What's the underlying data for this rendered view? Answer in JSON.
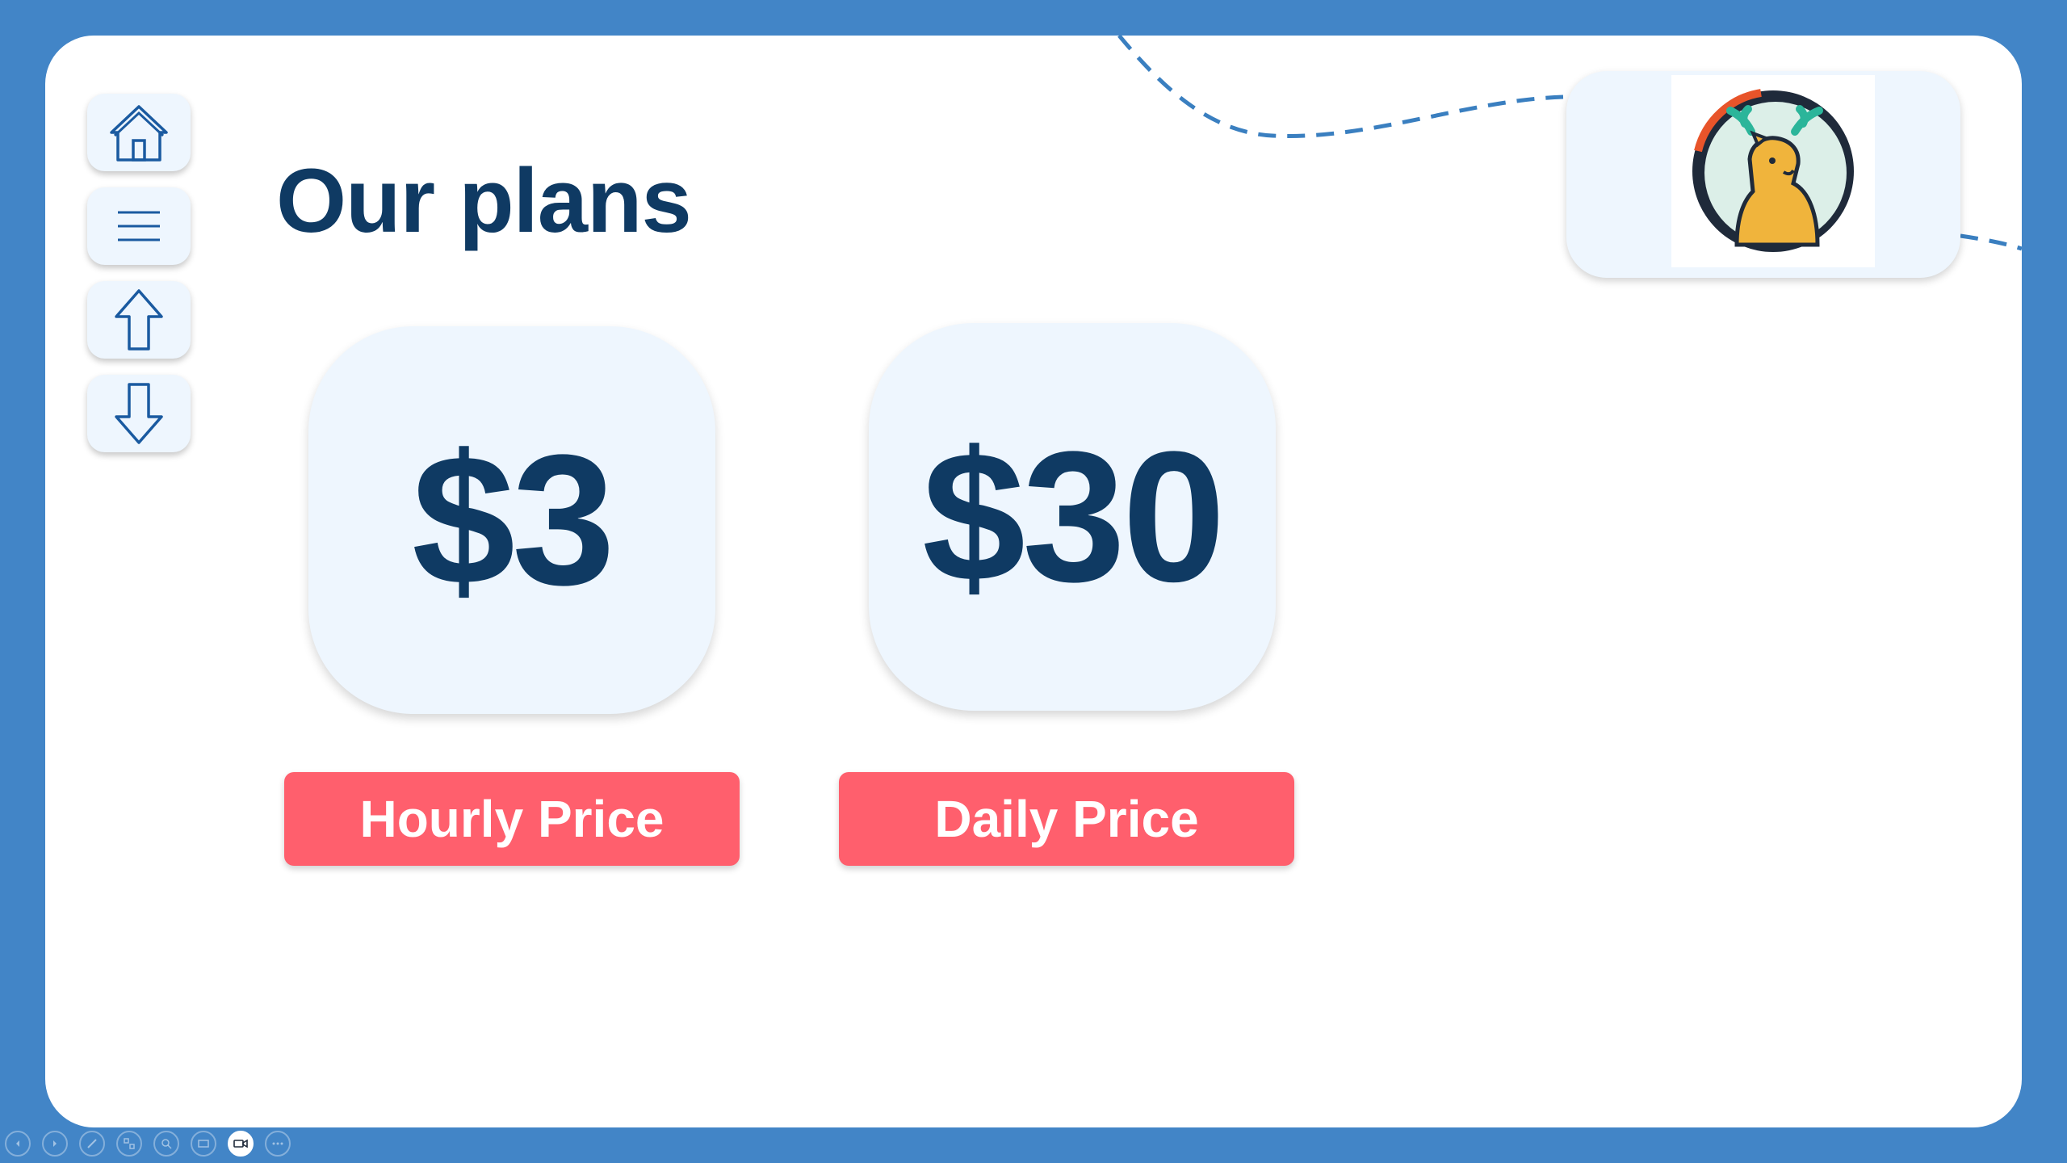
{
  "slide": {
    "title": "Our plans"
  },
  "nav": [
    {
      "icon": "home-icon"
    },
    {
      "icon": "menu-icon"
    },
    {
      "icon": "arrow-up-icon"
    },
    {
      "icon": "arrow-down-icon"
    }
  ],
  "plans": [
    {
      "price": "$3",
      "label": "Hourly Price"
    },
    {
      "price": "$30",
      "label": "Daily Price"
    }
  ],
  "logo": {
    "icon": "deer-logo-icon"
  },
  "toolbar": [
    {
      "icon": "previous-icon"
    },
    {
      "icon": "next-icon"
    },
    {
      "icon": "pen-icon"
    },
    {
      "icon": "slides-icon"
    },
    {
      "icon": "zoom-icon"
    },
    {
      "icon": "subtitles-icon"
    },
    {
      "icon": "camera-icon"
    },
    {
      "icon": "more-icon"
    }
  ],
  "colors": {
    "frame": "#4285c7",
    "card": "#eef6fe",
    "text": "#0f3a63",
    "accent": "#ff5f6d"
  }
}
